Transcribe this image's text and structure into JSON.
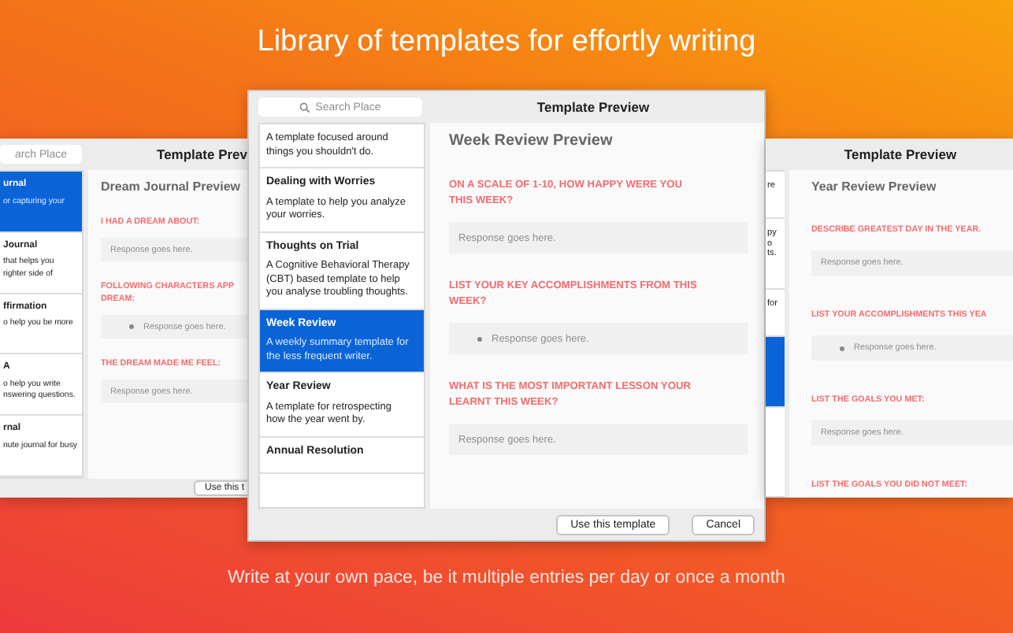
{
  "headline": "Library of templates for effortly writing",
  "windows": [
    {
      "title": "Template Prev",
      "search": {
        "placeholder": "arch Place",
        "icon": false
      },
      "sidebar": [
        {
          "title": "urnal",
          "description": [
            "or capturing your"
          ],
          "selected": true
        },
        {
          "title": "Journal",
          "description": [
            "that helps you",
            "righter side of"
          ],
          "selected": false
        },
        {
          "title": "ffirmation",
          "description": [
            "o help you be more"
          ],
          "selected": false
        },
        {
          "title": "A",
          "description": [
            "o help you write",
            "nswering questions."
          ],
          "selected": false
        },
        {
          "title": "rnal",
          "description": [
            "nute journal for busy"
          ],
          "selected": false
        }
      ],
      "preview": {
        "heading": "Dream Journal Preview",
        "questions": [
          {
            "label": [
              "I HAD A DREAM ABOUT:"
            ],
            "response": {
              "kind": "text",
              "placeholder": "Response goes here."
            }
          },
          {
            "label": [
              "FOLLOWING CHARACTERS APP",
              "DREAM:"
            ],
            "response": {
              "kind": "bullet",
              "placeholder": "Response goes here."
            }
          },
          {
            "label": [
              "THE DREAM MADE ME FEEL:"
            ],
            "response": {
              "kind": "text",
              "placeholder": "Response goes here."
            }
          }
        ]
      },
      "buttons": [
        "Use this t"
      ]
    },
    {
      "title": "Template Preview",
      "search": {
        "placeholder": "Search Place",
        "icon": true
      },
      "sidebar": [
        {
          "description": [
            "A template focused around",
            "things you shouldn't do."
          ],
          "selected": false
        },
        {
          "title": "Dealing with Worries",
          "description": [
            "A template to help you analyze",
            "your worries."
          ],
          "selected": false
        },
        {
          "title": "Thoughts on Trial",
          "description": [
            "A Cognitive Behavioral Therapy",
            "(CBT) based template to help",
            "you analyse troubling thoughts."
          ],
          "selected": false
        },
        {
          "title": "Week Review",
          "description": [
            "A weekly summary template for",
            "the less frequent writer."
          ],
          "selected": true
        },
        {
          "title": "Year Review",
          "description": [
            "A template for retrospecting",
            "how the year went by."
          ],
          "selected": false
        },
        {
          "title": "Annual Resolution",
          "selected": false
        }
      ],
      "preview": {
        "heading": "Week Review Preview",
        "questions": [
          {
            "label": [
              "ON A SCALE OF 1-10, HOW HAPPY WERE YOU",
              "THIS WEEK?"
            ],
            "response": {
              "kind": "text",
              "placeholder": "Response goes here."
            }
          },
          {
            "label": [
              "LIST YOUR KEY ACCOMPLISHMENTS FROM THIS",
              "WEEK?"
            ],
            "response": {
              "kind": "bullet",
              "placeholder": "Response goes here."
            }
          },
          {
            "label": [
              "WHAT IS THE MOST IMPORTANT LESSON YOUR",
              "LEARNT THIS WEEK?"
            ],
            "response": {
              "kind": "text",
              "placeholder": "Response goes here."
            }
          }
        ]
      },
      "buttons": [
        "Use this template",
        "Cancel"
      ]
    },
    {
      "title": "Template Preview",
      "sidebar": [
        {
          "description": [
            "re"
          ],
          "selected": false
        },
        {
          "description": [
            "py",
            "o",
            "ts."
          ],
          "selected": false
        },
        {
          "description": [
            "for"
          ],
          "selected": false
        },
        {
          "selected": true
        }
      ],
      "preview": {
        "heading": "Year Review Preview",
        "questions": [
          {
            "label": [
              "DESCRIBE GREATEST DAY IN THE YEAR."
            ],
            "response": {
              "kind": "text",
              "placeholder": "Response goes here."
            }
          },
          {
            "label": [
              "LIST YOUR ACCOMPLISHMENTS THIS YEA"
            ],
            "response": {
              "kind": "bullet",
              "placeholder": "Response goes here."
            }
          },
          {
            "label": [
              "LIST THE GOALS YOU MET:"
            ],
            "response": {
              "kind": "text",
              "placeholder": "Response goes here."
            }
          },
          {
            "label": [
              "LIST THE GOALS YOU DID NOT MEET:"
            ]
          }
        ]
      }
    }
  ],
  "footer": "Write at your own pace, be it multiple entries per day or once a month"
}
